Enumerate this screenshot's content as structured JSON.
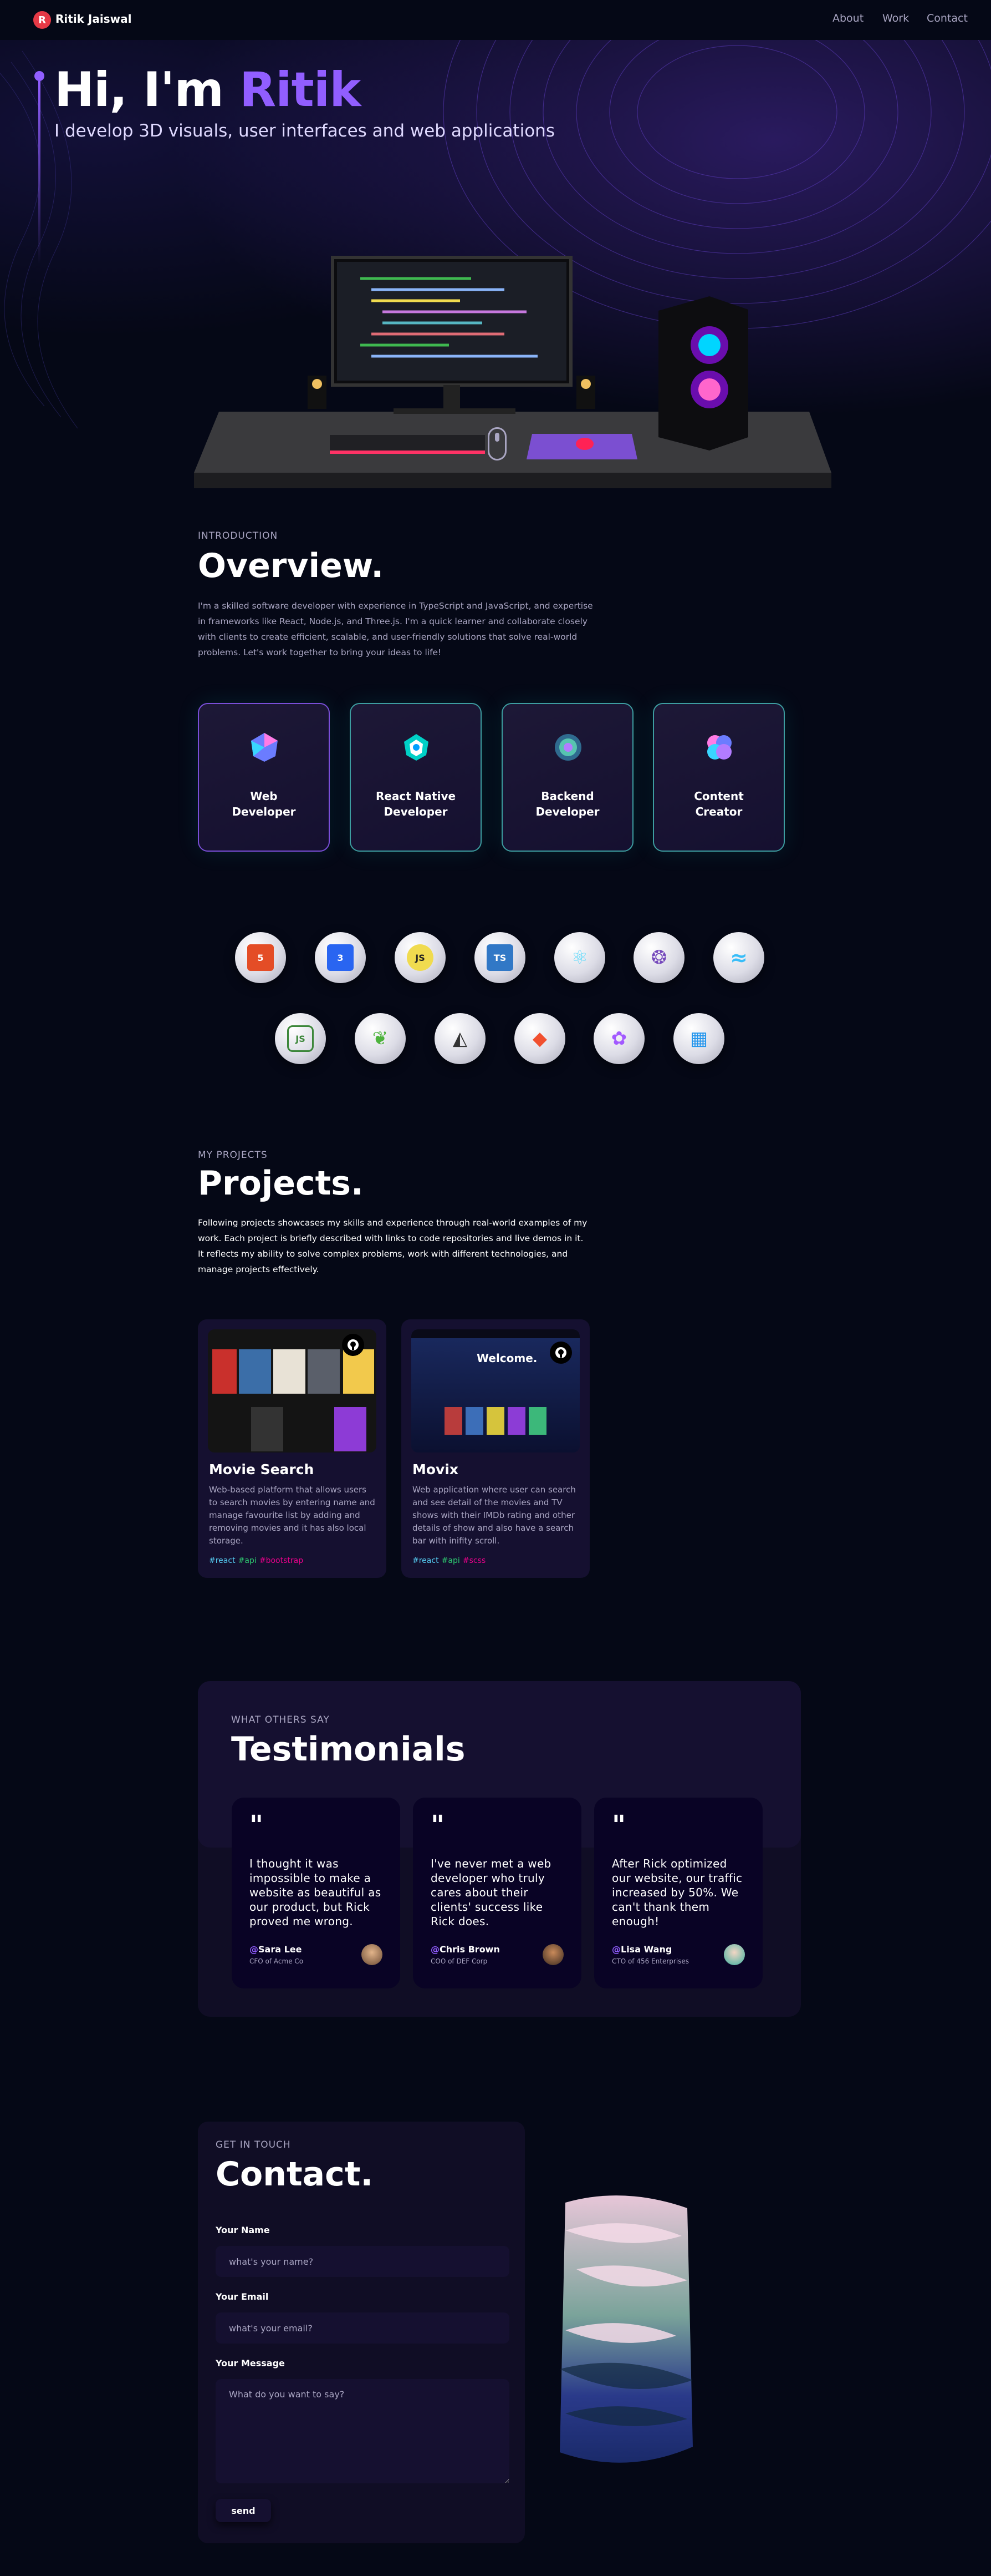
{
  "nav": {
    "brand": "Ritik Jaiswal",
    "links": [
      "About",
      "Work",
      "Contact"
    ],
    "logo_letter": "R"
  },
  "hero": {
    "title_prefix": "Hi, I'm ",
    "title_name": "Ritik",
    "subtitle": "I develop 3D visuals, user interfaces and web applications",
    "accent_color": "#915eff"
  },
  "overview": {
    "tag": "Introduction",
    "title": "Overview.",
    "paragraph": "I'm a skilled software developer with experience in TypeScript and JavaScript, and expertise in frameworks like React, Node.js, and Three.js. I'm a quick learner and collaborate closely with clients to create efficient, scalable, and user-friendly solutions that solve real-world problems. Let's work together to bring your ideas to life!",
    "services": [
      {
        "line1": "Web",
        "line2": "Developer",
        "icon": "web-icon"
      },
      {
        "line1": "React Native",
        "line2": "Developer",
        "icon": "mobile-icon"
      },
      {
        "line1": "Backend",
        "line2": "Developer",
        "icon": "backend-icon"
      },
      {
        "line1": "Content",
        "line2": "Creator",
        "icon": "creator-icon"
      }
    ]
  },
  "tech": [
    {
      "name": "html",
      "badge": "5",
      "color": "#e44d26"
    },
    {
      "name": "css",
      "badge": "3",
      "color": "#2965f1"
    },
    {
      "name": "javascript",
      "badge": "JS",
      "color": "#f0db4f"
    },
    {
      "name": "typescript",
      "badge": "TS",
      "color": "#3178c6"
    },
    {
      "name": "react",
      "badge": "⚛",
      "color": "#61dafb"
    },
    {
      "name": "redux",
      "badge": "❂",
      "color": "#764abc"
    },
    {
      "name": "tailwind",
      "badge": "≈",
      "color": "#38bdf8"
    },
    {
      "name": "nodejs",
      "badge": "JS",
      "color": "#3c873a"
    },
    {
      "name": "mongodb",
      "badge": "❦",
      "color": "#4db33d"
    },
    {
      "name": "threejs",
      "badge": "◭",
      "color": "#333333"
    },
    {
      "name": "git",
      "badge": "◆",
      "color": "#f1502f"
    },
    {
      "name": "figma",
      "badge": "✿",
      "color": "#a259ff"
    },
    {
      "name": "docker",
      "badge": "▦",
      "color": "#2496ed"
    }
  ],
  "projects": {
    "tag": "My projects",
    "title": "Projects.",
    "paragraph": "Following projects showcases my skills and experience through real-world examples of my work. Each project is briefly described with links to code repositories and live demos in it. It reflects my ability to solve complex problems, work with different technologies, and manage projects effectively.",
    "items": [
      {
        "title": "Movie Search",
        "description": "Web-based platform that allows users to search movies by entering name and manage favourite list by adding and removing movies and it has also local storage.",
        "tags": [
          {
            "text": "#react",
            "color": "#56ccf2"
          },
          {
            "text": "#api",
            "color": "#2ecc71"
          },
          {
            "text": "#bootstrap",
            "color": "#ec008c"
          }
        ]
      },
      {
        "title": "Movix",
        "description": "Web application where user can search and see detail of the movies and TV shows with their IMDb rating and other details of show and also have a search bar with inifity scroll.",
        "tags": [
          {
            "text": "#react",
            "color": "#56ccf2"
          },
          {
            "text": "#api",
            "color": "#2ecc71"
          },
          {
            "text": "#scss",
            "color": "#ec008c"
          }
        ],
        "banner_text": "Welcome."
      }
    ]
  },
  "testimonials": {
    "tag": "What others say",
    "title": "Testimonials",
    "quote_mark": "\"",
    "items": [
      {
        "text": "I thought it was impossible to make a website as beautiful as our product, but Rick proved me wrong.",
        "at": "@",
        "name": "Sara Lee",
        "role": "CFO of Acme Co"
      },
      {
        "text": "I've never met a web developer who truly cares about their clients' success like Rick does.",
        "at": "@",
        "name": "Chris Brown",
        "role": "COO of DEF Corp"
      },
      {
        "text": "After Rick optimized our website, our traffic increased by 50%. We can't thank them enough!",
        "at": "@",
        "name": "Lisa Wang",
        "role": "CTO of 456 Enterprises"
      }
    ]
  },
  "contact": {
    "tag": "Get in touch",
    "title": "Contact.",
    "name_label": "Your Name",
    "name_placeholder": "what's your name?",
    "email_label": "Your Email",
    "email_placeholder": "what's your email?",
    "message_label": "Your Message",
    "message_placeholder": "What do you want to say?",
    "send_label": "send"
  }
}
